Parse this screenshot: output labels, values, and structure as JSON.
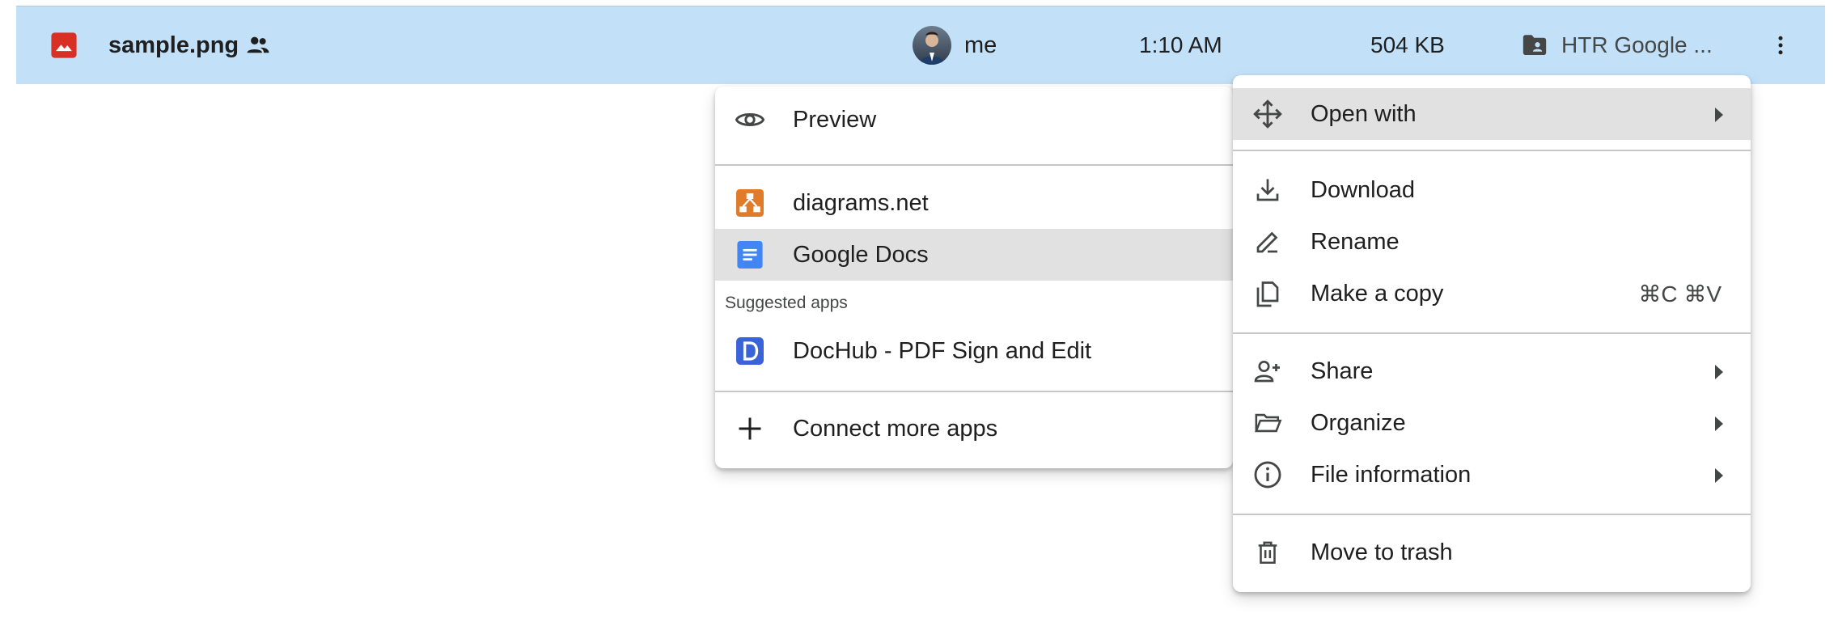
{
  "file_row": {
    "name": "sample.png",
    "owner": "me",
    "modified": "1:10 AM",
    "size": "504 KB",
    "location": "HTR Google ..."
  },
  "open_with_menu": {
    "preview": "Preview",
    "apps": [
      "diagrams.net",
      "Google Docs"
    ],
    "suggested_header": "Suggested apps",
    "suggested": [
      "DocHub - PDF Sign and Edit"
    ],
    "connect": "Connect more apps"
  },
  "context_menu": {
    "open_with": "Open with",
    "download": "Download",
    "rename": "Rename",
    "make_copy": "Make a copy",
    "make_copy_shortcut": "⌘C ⌘V",
    "share": "Share",
    "organize": "Organize",
    "file_information": "File information",
    "move_to_trash": "Move to trash"
  },
  "colors": {
    "row_selected": "#c2e1f9",
    "image_icon": "#d93025",
    "diagrams_icon": "#e07b2a",
    "docs_icon": "#4285f4",
    "dochub_icon": "#3b63d9",
    "hover": "#e1e1e1"
  },
  "icons": {
    "file_type": "image-icon",
    "shared": "people-icon",
    "location": "shared-folder-icon",
    "more": "more-vert-icon"
  }
}
